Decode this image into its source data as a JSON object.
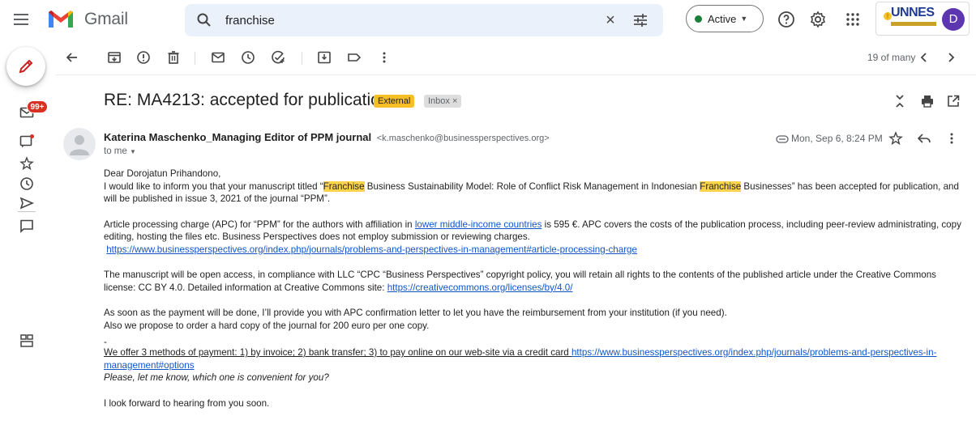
{
  "header": {
    "app_name": "Gmail",
    "search_value": "franchise",
    "status_label": "Active",
    "avatar_letter": "D",
    "brand": "UNNES"
  },
  "left_rail": {
    "unread_badge": "99+"
  },
  "toolbar": {
    "pager": "19 of many"
  },
  "email": {
    "subject": "RE: MA4213: accepted for publication",
    "labels": {
      "external": "External",
      "inbox": "Inbox ×"
    },
    "sender_name": "Katerina Maschenko_Managing Editor of PPM journal",
    "sender_email": "<k.maschenko@businessperspectives.org>",
    "to": "to me",
    "date": "Mon, Sep 6, 8:24 PM",
    "body": {
      "greeting": "Dear Dorojatun Prihandono,",
      "p1_a": "I would like to inform you that your manuscript titled “",
      "p1_hl1": "Franchise",
      "p1_b": " Business Sustainability Model: Role of Conflict Risk Management in Indonesian ",
      "p1_hl2": "Franchise",
      "p1_c": " Businesses” has been accepted for publication, and will be published in issue 3, 2021 of the journal “PPM”.",
      "p2_a": "Article processing charge (APC) for “PPM” for the authors with affiliation in ",
      "p2_link": "lower middle-income countries",
      "p2_b": "  is 595 €. APC covers the costs of the publication process, including peer-review administrating, copy editing, hosting the files etc. Business Perspectives does not employ submission or reviewing charges.",
      "p2_url": "https://www.businessperspectives.org/index.php/journals/problems-and-perspectives-in-management#article-processing-charge",
      "p3_a": "The manuscript will be open access, in compliance with LLC “CPC “Business Perspectives” copyright policy, you will retain all rights to the contents of the published article under the Creative Commons license: CC BY 4.0. Detailed information at Creative Commons site: ",
      "p3_url": "https://creativecommons.org/licenses/by/4.0/",
      "p4_a": "As soon as the payment will be done, I’ll provide you with APC confirmation letter to let you have the reimbursement from your institution (if you need).",
      "p4_b": "Also we propose to order a hard copy of the journal for 200 euro per one copy.",
      "dash": "-",
      "p5_a": "We offer 3 methods of payment: 1) by invoice; 2) bank transfer; 3) to pay online on our web-site via a credit card ",
      "p5_url": "https://www.businessperspectives.org/index.php/journals/problems-and-perspectives-in-management#options",
      "p5_b": "Please, let me know, which one is convenient for you?",
      "closing": "I look forward to hearing from you soon."
    }
  },
  "colors": {
    "accent": "#1155cc",
    "highlight": "#fcd34d",
    "external_tag": "#f6bf26",
    "active_dot": "#188038",
    "badge": "#d93025"
  }
}
